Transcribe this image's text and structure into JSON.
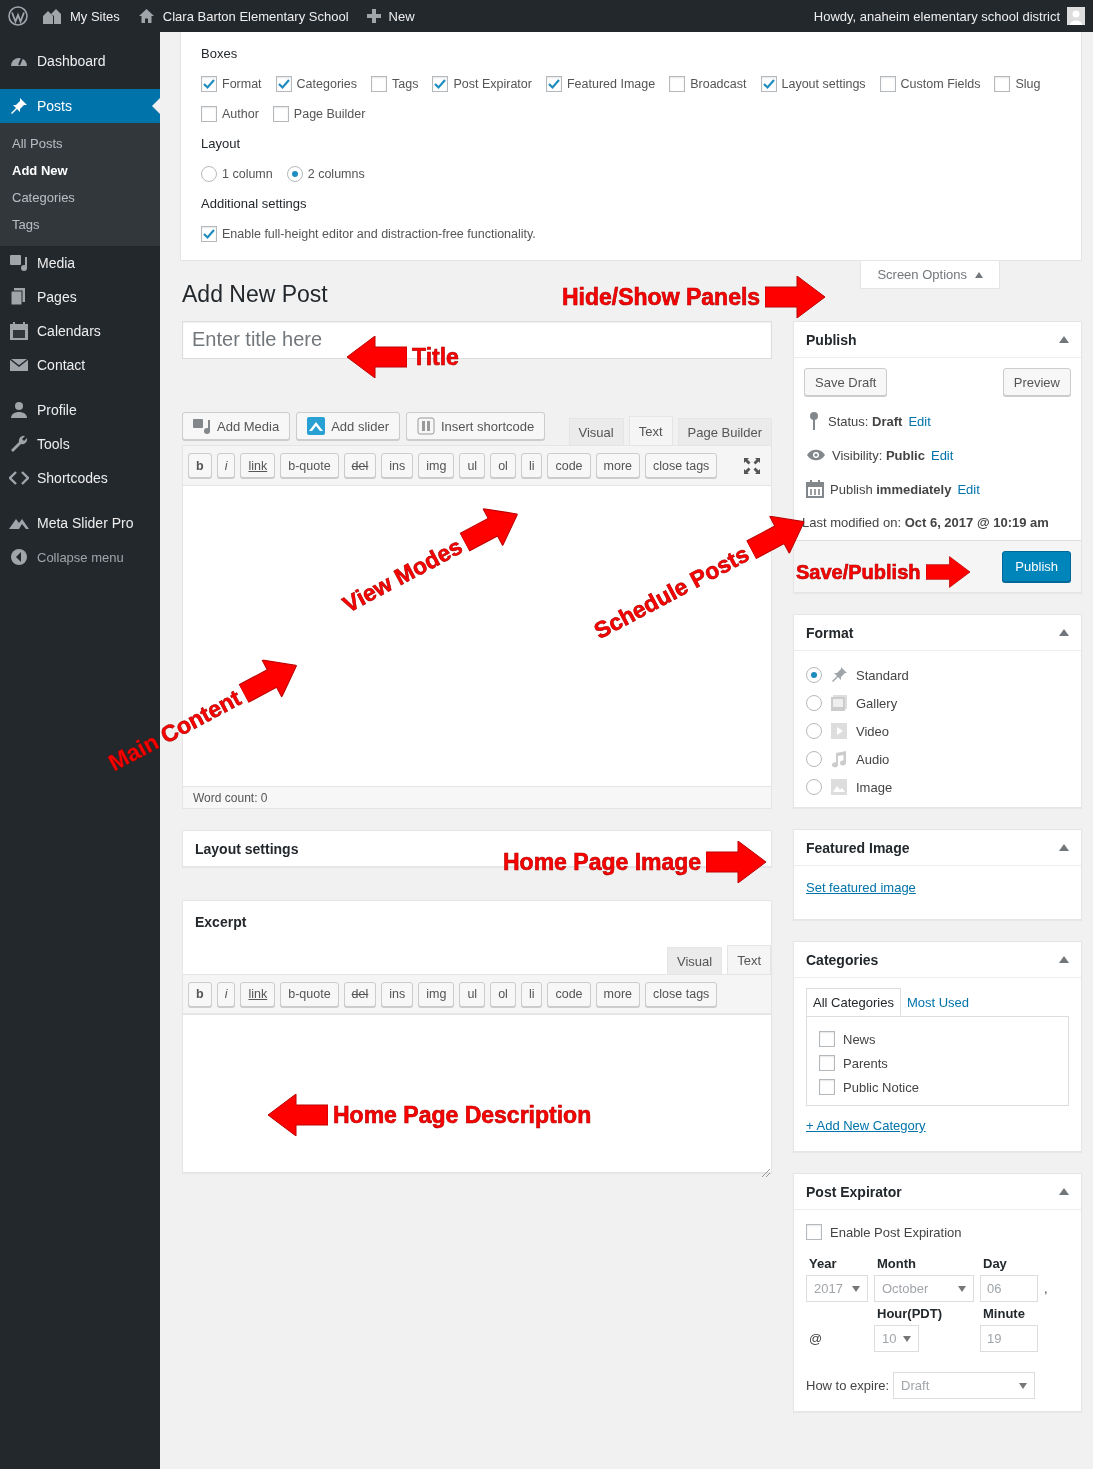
{
  "top_bar": {
    "items": [
      {
        "label": "My Sites",
        "kind": "sites"
      },
      {
        "label": "Clara Barton Elementary School",
        "kind": "home"
      },
      {
        "label": "New",
        "kind": "new"
      }
    ],
    "greeting": "Howdy, anaheim elementary school district"
  },
  "sidebar": {
    "sections": [
      {
        "items": [
          {
            "label": "Dashboard",
            "kind": "dashboard",
            "selected": false
          }
        ]
      },
      {
        "items": [
          {
            "label": "Posts",
            "kind": "posts",
            "selected": true,
            "children": [
              {
                "label": "All Posts",
                "selected": false
              },
              {
                "label": "Add New",
                "selected": true
              },
              {
                "label": "Categories",
                "selected": false
              },
              {
                "label": "Tags",
                "selected": false
              }
            ]
          },
          {
            "label": "Media",
            "kind": "media",
            "selected": false
          },
          {
            "label": "Pages",
            "kind": "pages",
            "selected": false
          },
          {
            "label": "Calendars",
            "kind": "calendar",
            "selected": false
          },
          {
            "label": "Contact",
            "kind": "contact",
            "selected": false
          }
        ]
      },
      {
        "items": [
          {
            "label": "Profile",
            "kind": "profile",
            "selected": false
          },
          {
            "label": "Tools",
            "kind": "tools",
            "selected": false
          },
          {
            "label": "Shortcodes",
            "kind": "shortcodes",
            "selected": false
          }
        ]
      },
      {
        "items": [
          {
            "label": "Meta Slider Pro",
            "kind": "slider",
            "selected": false
          },
          {
            "label": "Collapse menu",
            "kind": "collapse",
            "selected": false
          }
        ]
      }
    ]
  },
  "screen_options": {
    "boxes_heading": "Boxes",
    "boxes": [
      {
        "label": "Format",
        "checked": true
      },
      {
        "label": "Categories",
        "checked": true
      },
      {
        "label": "Tags",
        "checked": false
      },
      {
        "label": "Post Expirator",
        "checked": true
      },
      {
        "label": "Featured Image",
        "checked": true
      },
      {
        "label": "Broadcast",
        "checked": false
      },
      {
        "label": "Layout settings",
        "checked": true
      },
      {
        "label": "Custom Fields",
        "checked": false
      },
      {
        "label": "Slug",
        "checked": false
      },
      {
        "label": "Author",
        "checked": false
      },
      {
        "label": "Page Builder",
        "checked": false
      }
    ],
    "layout_heading": "Layout",
    "layout_options": [
      {
        "label": "1 column",
        "selected": false
      },
      {
        "label": "2 columns",
        "selected": true
      }
    ],
    "additional_heading": "Additional settings",
    "additional": [
      {
        "label": "Enable full-height editor and distraction-free functionality.",
        "checked": true
      }
    ],
    "toggle": "Screen Options"
  },
  "page_title": "Add New Post",
  "title_field": {
    "placeholder": "Enter title here"
  },
  "media_buttons": [
    {
      "label": "Add Media",
      "kind": "media"
    },
    {
      "label": "Add slider",
      "kind": "slider"
    },
    {
      "label": "Insert shortcode",
      "kind": "shortcode"
    }
  ],
  "editor": {
    "tabs": [
      {
        "label": "Visual",
        "selected": false
      },
      {
        "label": "Text",
        "selected": true
      },
      {
        "label": "Page Builder",
        "selected": false
      }
    ],
    "quicktags": [
      {
        "label": "b",
        "kind": "bold"
      },
      {
        "label": "i",
        "kind": "italic"
      },
      {
        "label": "link",
        "kind": "link"
      },
      {
        "label": "b-quote",
        "kind": "plain"
      },
      {
        "label": "del",
        "kind": "strike"
      },
      {
        "label": "ins",
        "kind": "plain"
      },
      {
        "label": "img",
        "kind": "plain"
      },
      {
        "label": "ul",
        "kind": "plain"
      },
      {
        "label": "ol",
        "kind": "plain"
      },
      {
        "label": "li",
        "kind": "plain"
      },
      {
        "label": "code",
        "kind": "plain"
      },
      {
        "label": "more",
        "kind": "plain"
      },
      {
        "label": "close tags",
        "kind": "plain"
      }
    ],
    "word_count": "Word count: 0"
  },
  "layout_settings": {
    "title": "Layout settings"
  },
  "excerpt": {
    "title": "Excerpt",
    "tabs": [
      {
        "label": "Visual",
        "selected": false
      },
      {
        "label": "Text",
        "selected": true
      }
    ],
    "quicktags": [
      {
        "label": "b",
        "kind": "bold"
      },
      {
        "label": "i",
        "kind": "italic"
      },
      {
        "label": "link",
        "kind": "link"
      },
      {
        "label": "b-quote",
        "kind": "plain"
      },
      {
        "label": "del",
        "kind": "strike"
      },
      {
        "label": "ins",
        "kind": "plain"
      },
      {
        "label": "img",
        "kind": "plain"
      },
      {
        "label": "ul",
        "kind": "plain"
      },
      {
        "label": "ol",
        "kind": "plain"
      },
      {
        "label": "li",
        "kind": "plain"
      },
      {
        "label": "code",
        "kind": "plain"
      },
      {
        "label": "more",
        "kind": "plain"
      },
      {
        "label": "close tags",
        "kind": "plain"
      }
    ]
  },
  "publish": {
    "title": "Publish",
    "save_draft": "Save Draft",
    "preview": "Preview",
    "lines": [
      {
        "kind": "status",
        "text": "Status: **Draft**",
        "link": "Edit"
      },
      {
        "kind": "visibility",
        "text": "Visibility: **Public**",
        "link": "Edit"
      },
      {
        "kind": "schedule",
        "text": "Publish **immediately**",
        "link": "Edit"
      }
    ],
    "last_modified": "Last modified on: **Oct 6, 2017 @ 10:19 am**",
    "publish_button": "Publish"
  },
  "format": {
    "title": "Format",
    "options": [
      {
        "label": "Standard",
        "kind": "standard",
        "selected": true
      },
      {
        "label": "Gallery",
        "kind": "gallery",
        "selected": false
      },
      {
        "label": "Video",
        "kind": "video",
        "selected": false
      },
      {
        "label": "Audio",
        "kind": "audio",
        "selected": false
      },
      {
        "label": "Image",
        "kind": "image",
        "selected": false
      }
    ]
  },
  "featured_image": {
    "title": "Featured Image",
    "link": "Set featured image"
  },
  "categories": {
    "title": "Categories",
    "tabs": [
      {
        "label": "All Categories",
        "selected": true
      },
      {
        "label": "Most Used",
        "selected": false
      }
    ],
    "items": [
      {
        "label": "News",
        "checked": false
      },
      {
        "label": "Parents",
        "checked": false
      },
      {
        "label": "Public Notice",
        "checked": false
      }
    ],
    "add_link": "+ Add New Category"
  },
  "post_expirator": {
    "title": "Post Expirator",
    "enable": {
      "label": "Enable Post Expiration",
      "checked": false
    },
    "year": {
      "label": "Year",
      "value": "2017"
    },
    "month": {
      "label": "Month",
      "value": "October"
    },
    "day": {
      "label": "Day",
      "value": "06"
    },
    "separator": ",",
    "at": "@",
    "hour": {
      "label": "Hour(PDT)",
      "value": "10"
    },
    "minute": {
      "label": "Minute",
      "value": "19"
    },
    "how_label": "How to expire:",
    "how_value": "Draft"
  },
  "annotations": [
    {
      "text": "Hide/Show Panels",
      "kind": "right"
    },
    {
      "text": "Title",
      "kind": "left"
    },
    {
      "text": "View Modes",
      "kind": "diagonal"
    },
    {
      "text": "Schedule Posts",
      "kind": "diagonal"
    },
    {
      "text": "Main Content",
      "kind": "diagonal"
    },
    {
      "text": "Save/Publish",
      "kind": "right"
    },
    {
      "text": "Home Page Image",
      "kind": "right"
    },
    {
      "text": "Home Page Description",
      "kind": "left"
    }
  ]
}
